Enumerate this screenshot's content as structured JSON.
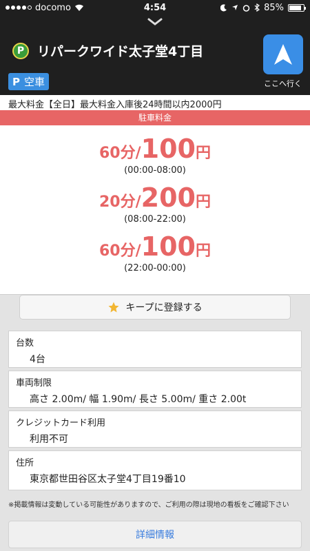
{
  "status": {
    "carrier": "docomo",
    "time": "4:54",
    "battery": "85%",
    "battery_level": 0.85
  },
  "header": {
    "title": "リパークワイド太子堂4丁目",
    "status_badge": "空車",
    "badge_icon": "P",
    "nav_label": "ここへ行く"
  },
  "max_fee": "最大料金【全日】最大料金入庫後24時間以内2000円",
  "fee_section_title": "駐車料金",
  "fees": [
    {
      "duration": "60分/",
      "price": "100",
      "unit": "円",
      "hours": "(00:00-08:00)"
    },
    {
      "duration": "20分/",
      "price": "200",
      "unit": "円",
      "hours": "(08:00-22:00)"
    },
    {
      "duration": "60分/",
      "price": "100",
      "unit": "円",
      "hours": "(22:00-00:00)"
    }
  ],
  "keep_button": "キープに登録する",
  "details": [
    {
      "label": "台数",
      "value": "4台"
    },
    {
      "label": "車両制限",
      "value": "高さ 2.00m/ 幅 1.90m/ 長さ 5.00m/ 重さ 2.00t"
    },
    {
      "label": "クレジットカード利用",
      "value": "利用不可"
    },
    {
      "label": "住所",
      "value": "東京都世田谷区太子堂4丁目19番10"
    }
  ],
  "note": "※掲載情報は変動している可能性がありますので、ご利用の際は現地の看板をご確認下さい",
  "detail_button": "詳細情報",
  "colors": {
    "accent_red": "#e76565",
    "accent_blue": "#3a8ee6",
    "header_dark": "#1f1f1f"
  }
}
